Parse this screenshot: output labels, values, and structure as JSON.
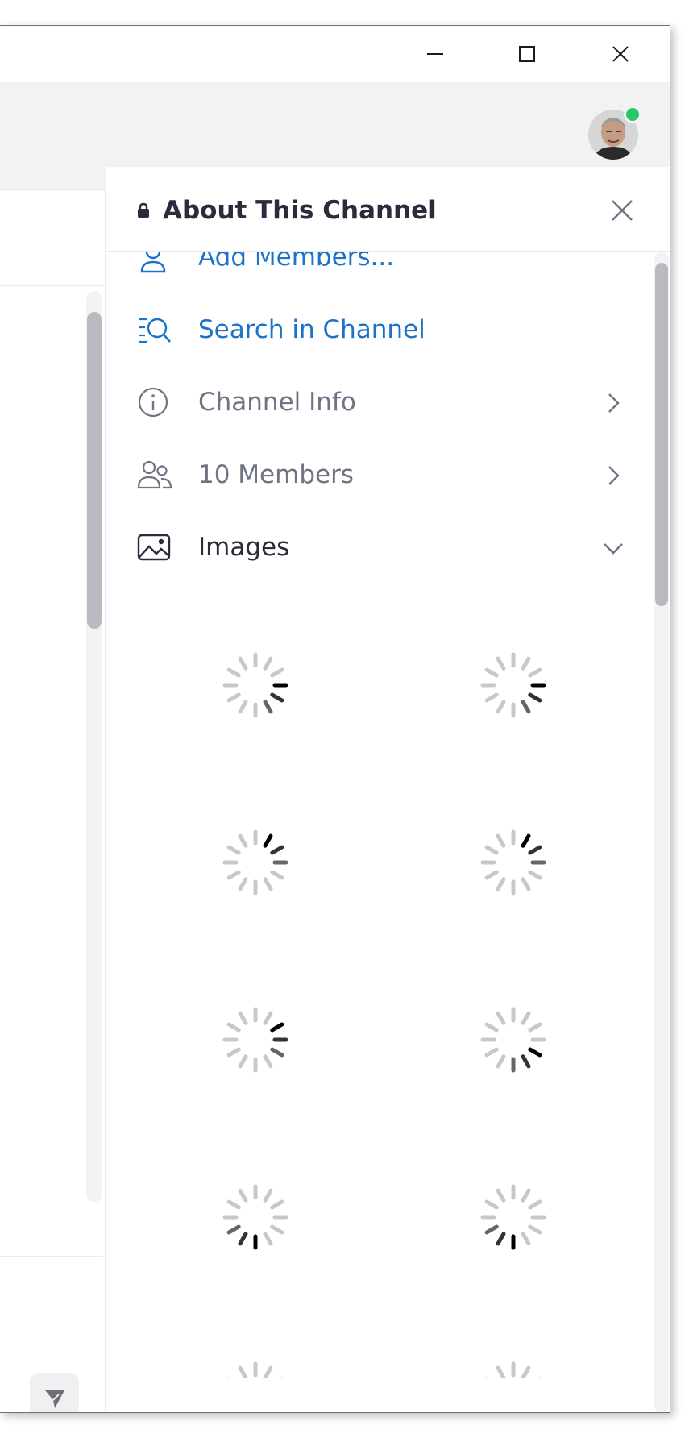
{
  "window": {
    "minimize_icon": "minimize-icon",
    "maximize_icon": "maximize-icon",
    "close_icon": "close-icon"
  },
  "user": {
    "presence": "online",
    "presence_color": "#2bc66a"
  },
  "panel": {
    "title": "About This Channel",
    "lock_icon": "lock-icon",
    "close_icon": "close-icon"
  },
  "menu": {
    "add_members": {
      "label": "Add Members...",
      "icon": "add-user-icon",
      "color": "#1a73c9"
    },
    "search": {
      "label": "Search in Channel",
      "icon": "search-list-icon",
      "color": "#1a73c9"
    },
    "channel_info": {
      "label": "Channel Info",
      "icon": "info-icon",
      "chevron": "chevron-right-icon",
      "color": "#6f7383"
    },
    "members": {
      "label": "10 Members",
      "icon": "users-icon",
      "chevron": "chevron-right-icon",
      "color": "#6f7383"
    },
    "images": {
      "label": "Images",
      "icon": "image-icon",
      "chevron": "chevron-down-icon",
      "color": "#2b2b3d"
    }
  },
  "images_loading": {
    "visible_spinners": 10,
    "state": "loading"
  },
  "composer": {
    "send_icon": "send-icon"
  }
}
